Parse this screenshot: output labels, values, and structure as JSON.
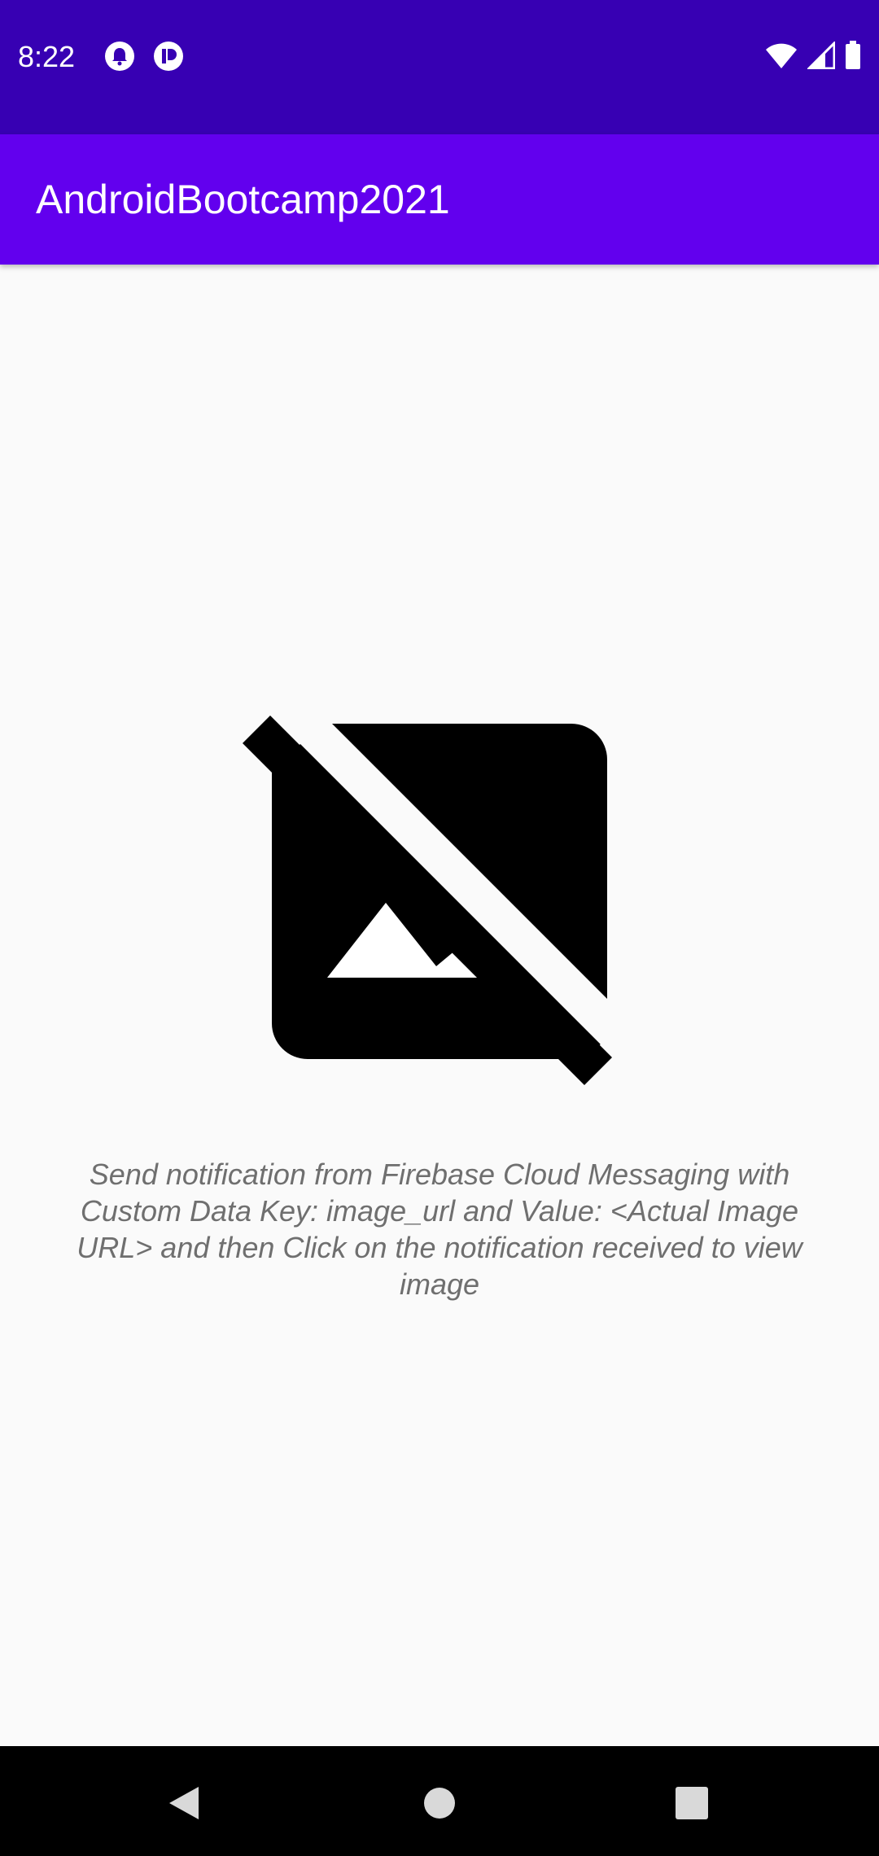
{
  "status_bar": {
    "time": "8:22",
    "notification_icons": [
      "notification-bell-icon",
      "notification-app-icon"
    ],
    "system_icons": [
      "wifi-icon",
      "cellular-signal-icon",
      "battery-icon"
    ],
    "background_color": "#3700b3"
  },
  "app_bar": {
    "title": "AndroidBootcamp2021",
    "background_color": "#6200ee"
  },
  "main": {
    "image_placeholder_icon": "broken-image-icon",
    "instructions": "Send notification from Firebase Cloud Messaging with Custom Data Key: image_url and Value: <Actual Image URL> and then Click on the notification received to view image"
  },
  "nav_bar": {
    "buttons": [
      "back-icon",
      "home-icon",
      "recents-icon"
    ]
  }
}
